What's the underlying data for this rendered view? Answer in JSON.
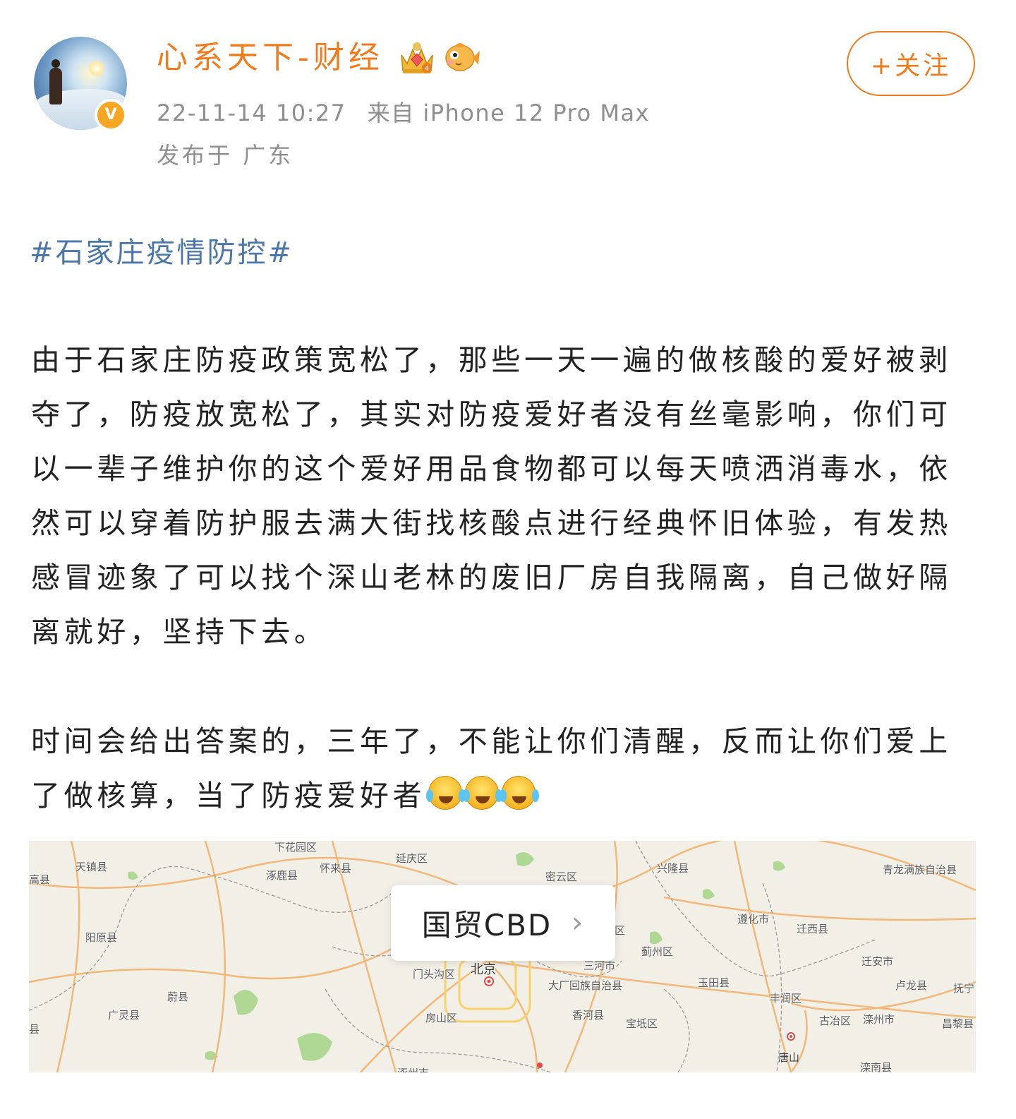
{
  "post": {
    "author": {
      "name": "心系天下-财经",
      "avatar_icon": "avatar-photo",
      "verified_badge": "V",
      "badge_icons": [
        "crown-level-icon",
        "fish-icon"
      ]
    },
    "timestamp": "22-11-14 10:27",
    "source": "来自 iPhone 12 Pro Max",
    "location": "发布于 广东",
    "follow_label": "+关注",
    "hashtag": "#石家庄疫情防控#",
    "paragraph_1": "由于石家庄防疫政策宽松了，那些一天一遍的做核酸的爱好被剥夺了，防疫放宽松了，其实对防疫爱好者没有丝毫影响，你们可以一辈子维护你的这个爱好用品食物都可以每天喷洒消毒水，依然可以穿着防护服去满大街找核酸点进行经典怀旧体验，有发热感冒迹象了可以找个深山老林的废旧厂房自我隔离，自己做好隔离就好，坚持下去。",
    "paragraph_2": "时间会给出答案的，三年了，不能让你们清醒，反而让你们爱上了做核算，当了防疫爱好者",
    "emojis": [
      "laugh-cry-emoji",
      "laugh-cry-emoji",
      "laugh-cry-emoji"
    ]
  },
  "map": {
    "poi_name": "国贸CBD",
    "labels": {
      "xiahuayuan": "下花园区",
      "yanqing": "延庆区",
      "tianzhen": "天镇县",
      "huailai": "怀来县",
      "zhuolu": "涿鹿县",
      "miyun": "密云区",
      "xinglong": "兴隆县",
      "qinglong": "青龙满族自治县",
      "gao": "高县",
      "yangyuan": "阳原县",
      "zunhua": "遵化市",
      "qianxi": "迁西县",
      "qu": "区",
      "jizhou": "蓟州区",
      "qianan": "迁安市",
      "beijing": "北京",
      "mentougou": "门头沟区",
      "sanhe": "三河市",
      "dachang": "大厂回族自治县",
      "yutian": "玉田县",
      "lulong": "卢龙县",
      "funing": "抚宁",
      "yu": "蔚县",
      "fengrun": "丰润区",
      "guangling": "广灵县",
      "fangshan": "房山区",
      "xianghe": "香河县",
      "baodi": "宝坻区",
      "guye": "古冶区",
      "luanzhou": "滦州市",
      "changli": "昌黎县",
      "ji": "县",
      "tangshan": "唐山",
      "luannan": "滦南县",
      "zhuozhou": "涿州市"
    }
  },
  "colors": {
    "accent": "#f07b1d",
    "hashtag": "#4a76a8",
    "meta": "#8e8e8e",
    "verified": "#f7a623"
  }
}
